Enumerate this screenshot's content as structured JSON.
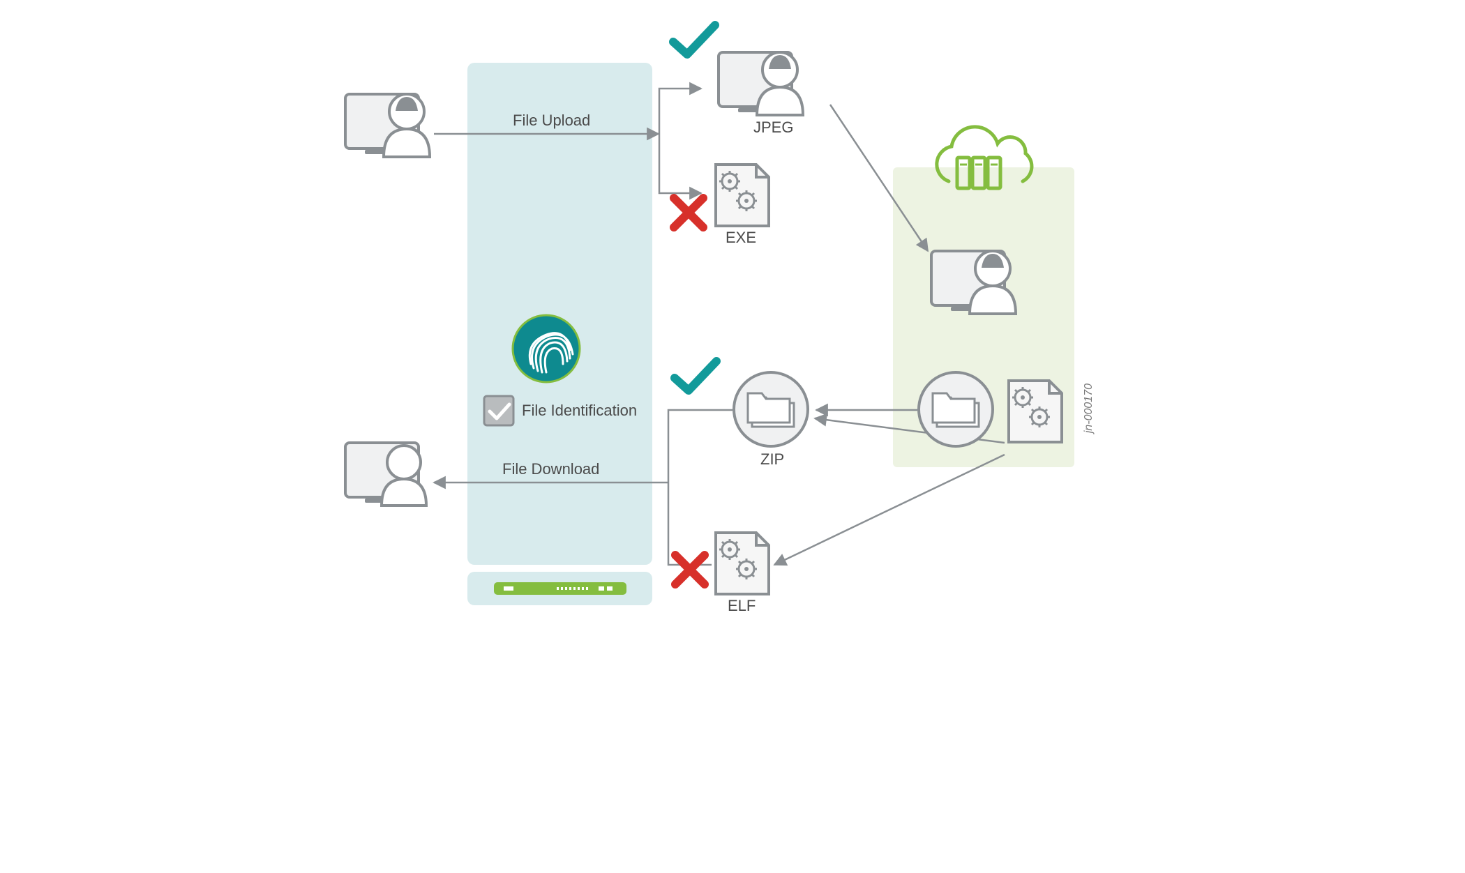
{
  "labels": {
    "file_upload": "File Upload",
    "file_download": "File Download",
    "file_identification": "File Identification",
    "jpeg": "JPEG",
    "exe": "EXE",
    "zip": "ZIP",
    "elf": "ELF"
  },
  "image_id": "jn-000170",
  "colors": {
    "stroke_gray": "#8a8f93",
    "fill_gray": "#f0f1f2",
    "teal": "#129a9a",
    "red": "#d7302a",
    "green": "#84bd3f",
    "panel_blue": "#d8ebed",
    "panel_green": "#edf3e2"
  }
}
